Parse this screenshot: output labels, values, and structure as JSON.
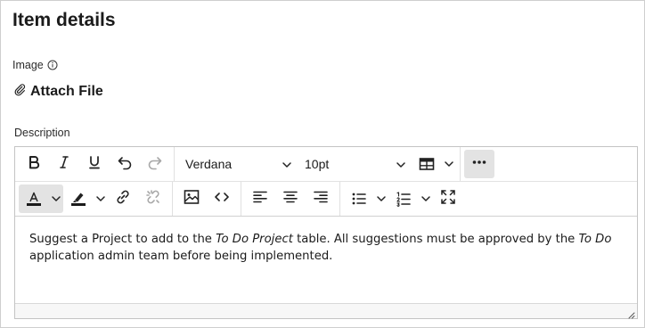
{
  "panel": {
    "title": "Item details"
  },
  "image_field": {
    "label": "Image",
    "info_icon": "info-circle-icon",
    "attach_label": "Attach File",
    "attach_icon": "paperclip-icon"
  },
  "description_field": {
    "label": "Description"
  },
  "toolbar": {
    "row1": {
      "buttons": [
        "bold-icon",
        "italic-icon",
        "underline-icon",
        "undo-icon",
        "redo-icon"
      ],
      "font_family": "Verdana",
      "font_size": "10pt",
      "table_icon": "table-icon",
      "more_icon": "more-horizontal-icon"
    },
    "row2": {
      "buttons": [
        "text-color-icon",
        "highlight-color-icon",
        "link-icon",
        "unlink-icon",
        "image-icon",
        "source-code-icon",
        "align-left-icon",
        "align-center-icon",
        "align-right-icon",
        "bullet-list-icon",
        "numbered-list-icon",
        "fullscreen-icon"
      ],
      "text_color": "#1b1b1b",
      "highlight_color": "#1b1b1b"
    }
  },
  "content": {
    "seg1": "Suggest a Project to add to the ",
    "seg2": "To Do Project",
    "seg3": " table. All suggestions must be approved by the ",
    "seg4": "To Do",
    "seg5": " application admin team before being implemented."
  }
}
